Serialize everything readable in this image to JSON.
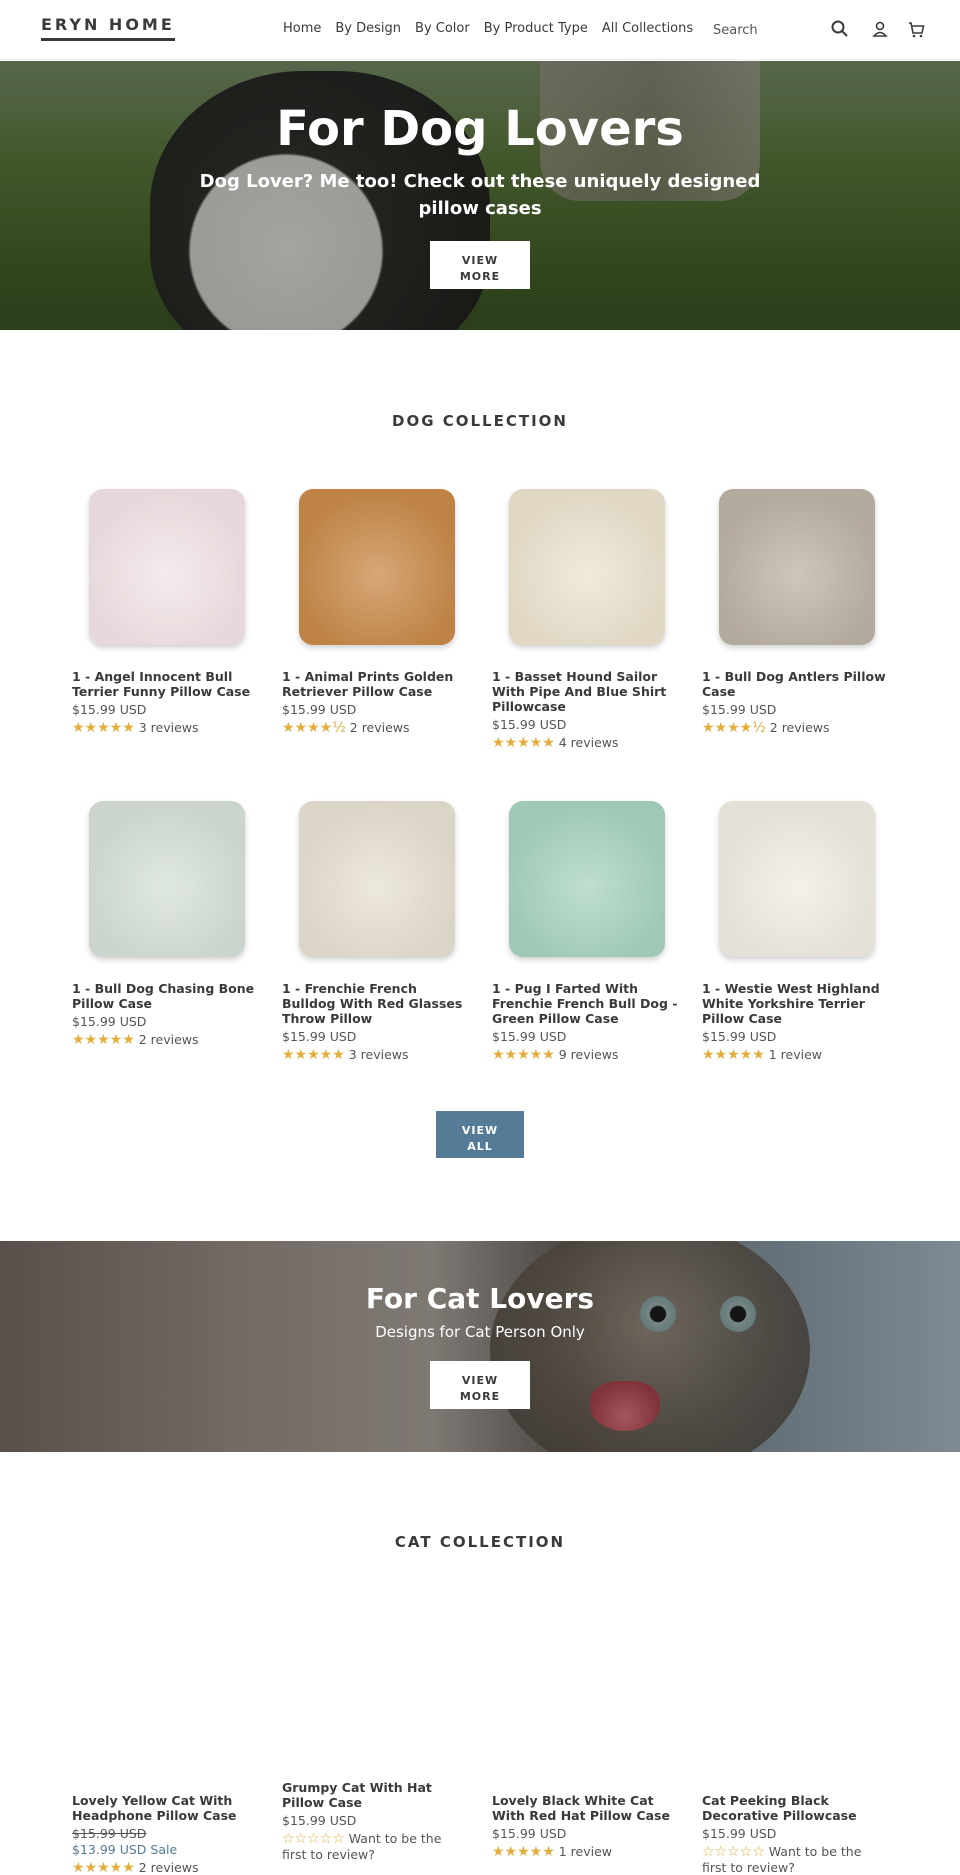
{
  "header": {
    "logo": "ERYN HOME",
    "nav": [
      "Home",
      "By Design",
      "By Color",
      "By Product Type",
      "All Collections"
    ],
    "search_placeholder": "Search"
  },
  "dog_hero": {
    "title": "For Dog Lovers",
    "subtitle_line1": "Dog Lover? Me too! Check out these uniquely designed",
    "subtitle_line2": "pillow cases",
    "button_line1": "VIEW",
    "button_line2": "MORE"
  },
  "dog_collection": {
    "title": "DOG COLLECTION",
    "products": [
      {
        "title": [
          "1 - Angel Innocent Bull",
          "Terrier Funny Pillow Case"
        ],
        "price": "$15.99 USD",
        "stars": "★★★★★",
        "reviews": "3 reviews",
        "bg": "#f2e4e6"
      },
      {
        "title": [
          "1 - Animal Prints Golden",
          "Retriever Pillow Case"
        ],
        "price": "$15.99 USD",
        "stars": "★★★★½",
        "reviews": "2 reviews",
        "bg": "#c98a4a"
      },
      {
        "title": [
          "1 - Basset Hound Sailor",
          "With Pipe And Blue Shirt",
          "Pillowcase"
        ],
        "price": "$15.99 USD",
        "stars": "★★★★★",
        "reviews": "4 reviews",
        "bg": "#ece3cf"
      },
      {
        "title": [
          "1 - Bull Dog Antlers Pillow",
          "Case"
        ],
        "price": "$15.99 USD",
        "stars": "★★★★½",
        "reviews": "2 reviews",
        "bg": "#bdb3a6"
      },
      {
        "title": [
          "1 - Bull Dog Chasing Bone",
          "Pillow Case"
        ],
        "price": "$15.99 USD",
        "stars": "★★★★★",
        "reviews": "2 reviews",
        "bg": "#d6e0d8"
      },
      {
        "title": [
          "1 - Frenchie French",
          "Bulldog With Red Glasses",
          "Throw Pillow"
        ],
        "price": "$15.99 USD",
        "stars": "★★★★★",
        "reviews": "3 reviews",
        "bg": "#e7e0d2"
      },
      {
        "title": [
          "1 - Pug I Farted With",
          "Frenchie French Bull Dog -",
          "Green Pillow Case"
        ],
        "price": "$15.99 USD",
        "stars": "★★★★★",
        "reviews": "9 reviews",
        "bg": "#a9d3c0"
      },
      {
        "title": [
          "1 - Westie West Highland",
          "White Yorkshire Terrier",
          "Pillow Case"
        ],
        "price": "$15.99 USD",
        "stars": "★★★★★",
        "reviews": "1 review",
        "bg": "#f0ece4"
      }
    ],
    "view_all_line1": "VIEW",
    "view_all_line2": "ALL"
  },
  "cat_hero": {
    "title": "For Cat Lovers",
    "subtitle": "Designs for Cat Person Only",
    "button_line1": "VIEW",
    "button_line2": "MORE"
  },
  "cat_collection": {
    "title": "CAT COLLECTION",
    "products": [
      {
        "title": [
          "Lovely Yellow Cat With",
          "Headphone Pillow Case"
        ],
        "old_price": "$15.99 USD",
        "sale_price": "$13.99 USD",
        "sale_label": "Sale",
        "stars": "★★★★★",
        "reviews": "2 reviews"
      },
      {
        "title": [
          "Grumpy Cat With Hat",
          "Pillow Case"
        ],
        "price": "$15.99 USD",
        "stars": "☆☆☆☆☆",
        "reviews_line1": "Want to be the",
        "reviews_line2": "first to review?"
      },
      {
        "title": [
          "Lovely Black White Cat",
          "With Red Hat Pillow Case"
        ],
        "price": "$15.99 USD",
        "stars": "★★★★★",
        "reviews": "1 review"
      },
      {
        "title": [
          "Cat Peeking Black",
          "Decorative Pillowcase"
        ],
        "price": "$15.99 USD",
        "stars": "☆☆☆☆☆",
        "reviews_line1": "Want to be the",
        "reviews_line2": "first to review?"
      }
    ]
  }
}
